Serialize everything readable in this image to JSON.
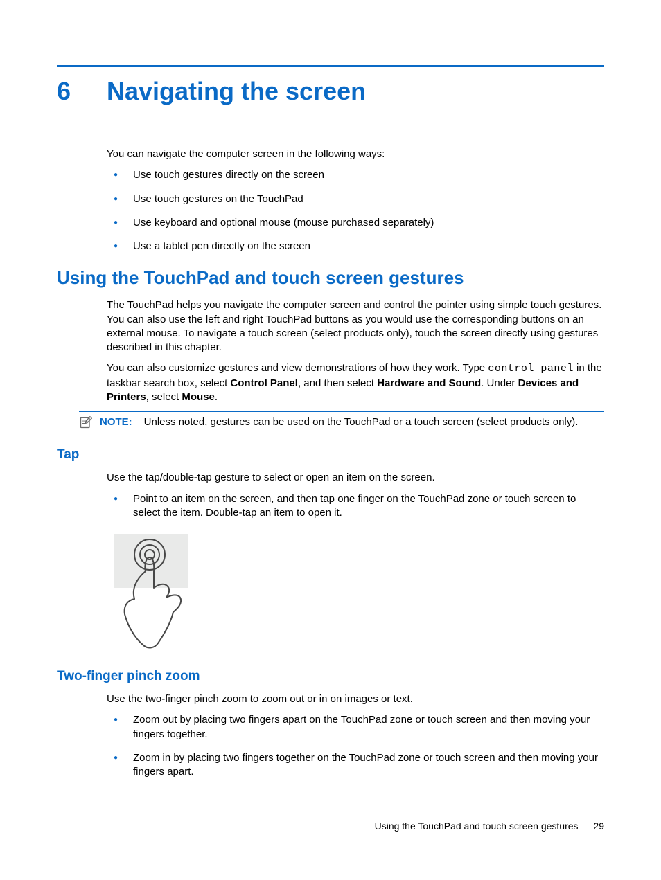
{
  "chapter": {
    "number": "6",
    "title": "Navigating the screen"
  },
  "intro": "You can navigate the computer screen in the following ways:",
  "intro_bullets": [
    "Use touch gestures directly on the screen",
    "Use touch gestures on the TouchPad",
    "Use keyboard and optional mouse (mouse purchased separately)",
    "Use a tablet pen directly on the screen"
  ],
  "section1": {
    "heading": "Using the TouchPad and touch screen gestures",
    "para1": "The TouchPad helps you navigate the computer screen and control the pointer using simple touch gestures. You can also use the left and right TouchPad buttons as you would use the corresponding buttons on an external mouse. To navigate a touch screen (select products only), touch the screen directly using gestures described in this chapter.",
    "para2_pre": "You can also customize gestures and view demonstrations of how they work. Type ",
    "para2_code": "control panel",
    "para2_mid1": " in the taskbar search box, select ",
    "para2_b1": "Control Panel",
    "para2_mid2": ", and then select ",
    "para2_b2": "Hardware and Sound",
    "para2_mid3": ". Under ",
    "para2_b3": "Devices and Printers",
    "para2_mid4": ", select ",
    "para2_b4": "Mouse",
    "para2_end": "."
  },
  "note": {
    "label": "NOTE:",
    "text": "Unless noted, gestures can be used on the TouchPad or a touch screen (select products only)."
  },
  "tap": {
    "heading": "Tap",
    "para": "Use the tap/double-tap gesture to select or open an item on the screen.",
    "bullets": [
      "Point to an item on the screen, and then tap one finger on the TouchPad zone or touch screen to select the item. Double-tap an item to open it."
    ]
  },
  "pinch": {
    "heading": "Two-finger pinch zoom",
    "para": "Use the two-finger pinch zoom to zoom out or in on images or text.",
    "bullets": [
      "Zoom out by placing two fingers apart on the TouchPad zone or touch screen and then moving your fingers together.",
      "Zoom in by placing two fingers together on the TouchPad zone or touch screen and then moving your fingers apart."
    ]
  },
  "footer": {
    "text": "Using the TouchPad and touch screen gestures",
    "page_number": "29"
  }
}
